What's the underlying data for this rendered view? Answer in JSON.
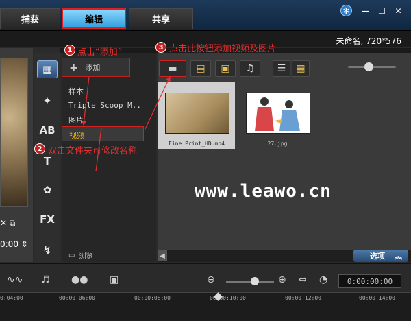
{
  "tabs": [
    {
      "label": "捕获"
    },
    {
      "label": "编辑"
    },
    {
      "label": "共享"
    }
  ],
  "window_controls": {
    "icons": [
      "snowflake-icon",
      "minimize-icon",
      "maximize-icon",
      "close-icon"
    ],
    "minimize": "—",
    "maximize": "☐",
    "close": "✕"
  },
  "project": {
    "name": "未命名, 720*576"
  },
  "left_panel": {
    "timecode": "0:00"
  },
  "strip_icons": [
    "media-library-icon",
    "transition-icon",
    "title-icon",
    "text-icon",
    "graphics-icon",
    "fx-icon",
    "path-icon"
  ],
  "strip_labels": {
    "title": "AB",
    "text": "T",
    "fx": "FX"
  },
  "library": {
    "add_label": "添加",
    "folders": [
      "样本",
      "Triple Scoop M..",
      "图片",
      "视频"
    ],
    "browse_label": "浏览"
  },
  "media": {
    "items": [
      {
        "label": "Fine Print_HD.mp4"
      },
      {
        "label": "27.jpg"
      }
    ]
  },
  "annotations": [
    {
      "num": "1",
      "text": "点击“添加”"
    },
    {
      "num": "2",
      "text": "双击文件夹可修改名称"
    },
    {
      "num": "3",
      "text": "点击此按钮添加视频及图片"
    }
  ],
  "watermark": "www.leawo.cn",
  "options_label": "选项",
  "timeline": {
    "timecode": "0:00:00:00",
    "ticks": [
      "0:04:00",
      "00:00:06:00",
      "00:00:08:00",
      "00:00:10:00",
      "00:00:12:00",
      "00:00:14:00"
    ]
  },
  "colors": {
    "accent_red": "#e03030",
    "selection_yellow": "#f4b400",
    "active_tab": "#2a9ddc"
  }
}
